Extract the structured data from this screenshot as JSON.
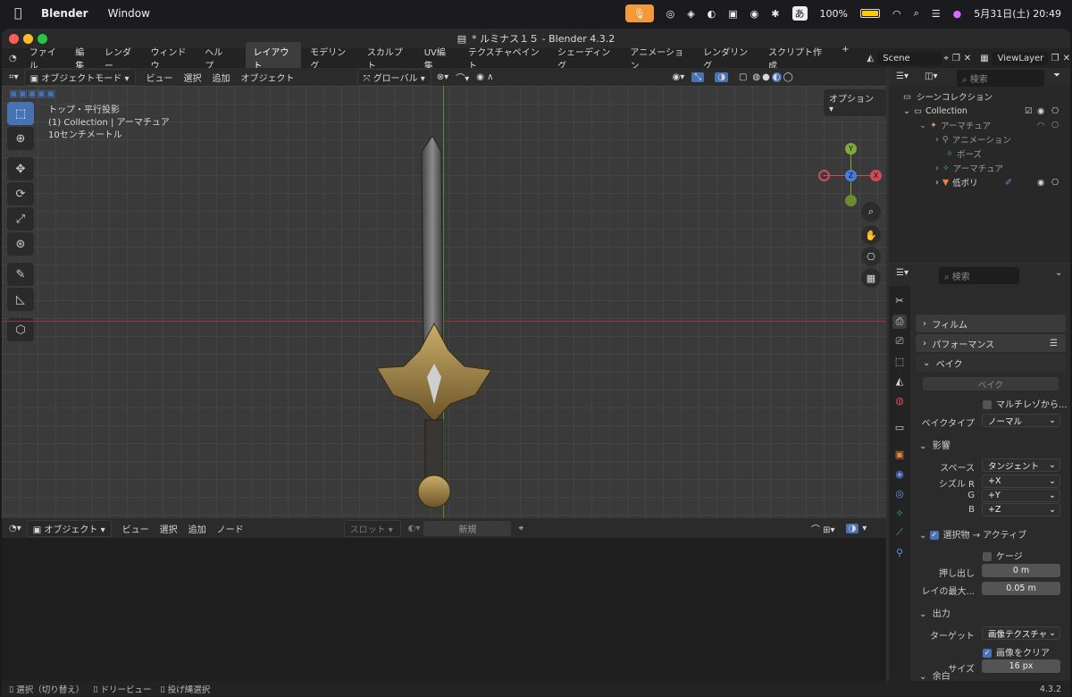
{
  "menubar": {
    "app": "Blender",
    "items": [
      "Window"
    ],
    "clock": "5月31日(土) 20:49",
    "battery": "100%",
    "ime": "あ"
  },
  "window": {
    "title": "* ルミナス１５ - Blender 4.3.2"
  },
  "topbar": {
    "menus": [
      "ファイル",
      "編集",
      "レンダー",
      "ウィンドウ",
      "ヘルプ"
    ],
    "workspaces": [
      "レイアウト",
      "モデリング",
      "スカルプト",
      "UV編集",
      "テクスチャペイント",
      "シェーディング",
      "アニメーション",
      "レンダリング",
      "スクリプト作成"
    ],
    "active_workspace": "レイアウト",
    "scene": "Scene",
    "view_layer": "ViewLayer"
  },
  "viewport": {
    "mode": "オブジェクトモード",
    "menus": [
      "ビュー",
      "選択",
      "追加",
      "オブジェクト"
    ],
    "transform": "グローバル",
    "options": "オプション",
    "info": [
      "トップ・平行投影",
      "(1) Collection | アーマチュア",
      "10センチメートル"
    ],
    "gizmo": {
      "y": "Y",
      "z": "Z",
      "x": "X"
    }
  },
  "node_editor": {
    "mode": "オブジェクト",
    "menus": [
      "ビュー",
      "選択",
      "追加",
      "ノード"
    ],
    "slot": "スロット",
    "new": "新規"
  },
  "outliner": {
    "search_placeholder": "検索",
    "scene_collection": "シーンコレクション",
    "rows": [
      "Collection",
      "アーマチュア",
      "アニメーション",
      "ポーズ",
      "アーマチュア",
      "低ポリ"
    ]
  },
  "properties": {
    "search_placeholder": "検索",
    "panels": {
      "film": "フィルム",
      "performance": "パフォーマンス",
      "bake": "ベイク"
    },
    "bake_button": "ベイク",
    "multires": "マルチレゾから...",
    "bake_type_label": "ベイクタイプ",
    "bake_type": "ノーマル",
    "influence": "影響",
    "space_label": "スペース",
    "space": "タンジェント",
    "swizzle_r_label": "シズル R",
    "swizzle_r": "+X",
    "g_label": "G",
    "g": "+Y",
    "b_label": "B",
    "b": "+Z",
    "selected_to_active": "選択物 → アクティブ",
    "cage": "ケージ",
    "extrusion_label": "押し出し",
    "extrusion": "0 m",
    "ray_label": "レイの最大...",
    "ray": "0.05 m",
    "output": "出力",
    "target_label": "ターゲット",
    "target": "画像テクスチャ",
    "clear_image": "画像をクリア",
    "margin": "余白",
    "size_label": "サイズ",
    "size": "16 px"
  },
  "status": {
    "select": "選択（切り替え）",
    "dolly": "ドリービュー",
    "lasso": "投げ縄選択",
    "version": "4.3.2"
  }
}
